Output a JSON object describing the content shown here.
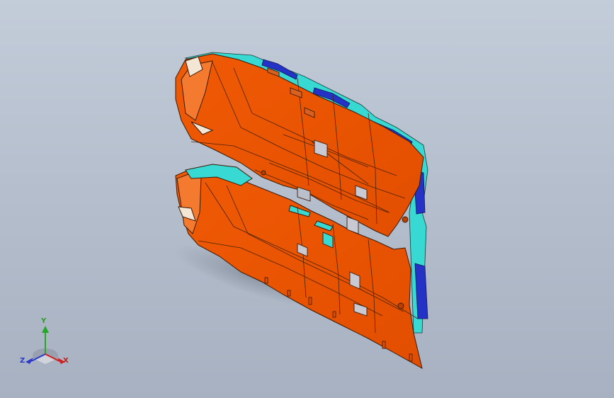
{
  "viewport": {
    "background_top": "#c3ccd9",
    "background_bottom": "#a7b1c1"
  },
  "model": {
    "colors": {
      "body": "#ee5500",
      "body_dark": "#b83f00",
      "edge": "#3a1a05",
      "cyan": "#38d9d2",
      "blue": "#2433c6",
      "cavity_light": "#f4e6d4"
    }
  },
  "triad": {
    "x_label": "X",
    "y_label": "Y",
    "z_label": "Z",
    "x_color": "#d21e1e",
    "y_color": "#25a825",
    "z_color": "#2b38c8",
    "icon": "coordinate-triad-icon"
  }
}
